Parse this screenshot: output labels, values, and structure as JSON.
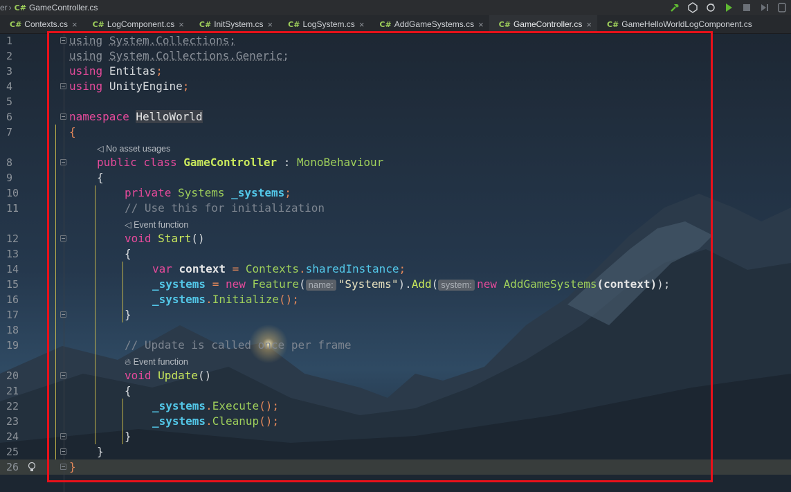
{
  "breadcrumb": {
    "file": "GameController.cs",
    "lang_badge": "C#",
    "prefix": "er"
  },
  "tabs": [
    {
      "label": "Contexts.cs",
      "active": false
    },
    {
      "label": "LogComponent.cs",
      "active": false
    },
    {
      "label": "InitSystem.cs",
      "active": false
    },
    {
      "label": "LogSystem.cs",
      "active": false
    },
    {
      "label": "AddGameSystems.cs",
      "active": false
    },
    {
      "label": "GameController.cs",
      "active": true
    },
    {
      "label": "GameHelloWorldLogComponent.cs",
      "active": false
    }
  ],
  "toolbar": {
    "icons": [
      "hammer-icon",
      "unity-icon",
      "refresh-icon",
      "play-icon",
      "stop-icon",
      "step-icon"
    ]
  },
  "hints": {
    "no_asset_usages": "No asset usages",
    "event_function_start": "Event function",
    "event_function_update": "Event function",
    "param_name": "name:",
    "param_system": "system:"
  },
  "line_numbers": [
    "1",
    "2",
    "3",
    "4",
    "5",
    "6",
    "7",
    "8",
    "9",
    "10",
    "11",
    "12",
    "13",
    "14",
    "15",
    "16",
    "17",
    "18",
    "19",
    "20",
    "21",
    "22",
    "23",
    "24",
    "25",
    "26"
  ],
  "code": {
    "l1_kw": "using",
    "l1_rest": "System.Collections;",
    "l2_kw": "using",
    "l2_rest": "System.Collections.Generic;",
    "l3_kw": "using",
    "l3_ns": "Entitas",
    "l3_semi": ";",
    "l4_kw": "using",
    "l4_ns": "UnityEngine",
    "l4_semi": ";",
    "l6_kw": "namespace",
    "l6_name": "HelloWorld",
    "l7": "{",
    "l8_kw": "public class",
    "l8_name": "GameController",
    "l8_colon": ":",
    "l8_base": "MonoBehaviour",
    "l9": "{",
    "l10_kw": "private",
    "l10_type": "Systems",
    "l10_field": "_systems",
    "l10_semi": ";",
    "l11": "// Use this for initialization",
    "l12_kw": "void",
    "l12_name": "Start",
    "l12_paren": "()",
    "l13": "{",
    "l14_kw": "var",
    "l14_var": "context",
    "l14_eq": "=",
    "l14_type": "Contexts",
    "l14_dot": ".",
    "l14_prop": "sharedInstance",
    "l14_semi": ";",
    "l15_field": "_systems",
    "l15_eq": "=",
    "l15_new": "new",
    "l15_type": "Feature",
    "l15_open": "(",
    "l15_str": "\"Systems\"",
    "l15_close": ").",
    "l15_add": "Add",
    "l15_open2": "(",
    "l15_new2": "new",
    "l15_type2": "AddGameSystems",
    "l15_arg": "(context)",
    "l15_end": ");",
    "l16_field": "_systems",
    "l16_dot": ".",
    "l16_meth": "Initialize",
    "l16_end": "();",
    "l17": "}",
    "l19": "// Update is called once per frame",
    "l20_kw": "void",
    "l20_name": "Update",
    "l20_paren": "()",
    "l21": "{",
    "l22_field": "_systems",
    "l22_dot": ".",
    "l22_meth": "Execute",
    "l22_end": "();",
    "l23_field": "_systems",
    "l23_dot": ".",
    "l23_meth": "Cleanup",
    "l23_end": "();",
    "l24": "}",
    "l25": "}",
    "l26": "}"
  },
  "colors": {
    "highlight_box": "#e8111a",
    "keyword": "#e64a9b",
    "type": "#9fd05b",
    "field": "#53c7e8",
    "indent_guide": "#d8c64a"
  }
}
